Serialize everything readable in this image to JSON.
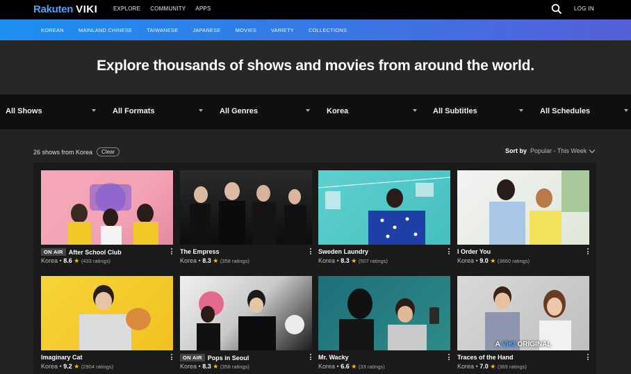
{
  "topbar": {
    "logo_part1": "Rakuten",
    "logo_part2": "VIKI",
    "nav": [
      "EXPLORE",
      "COMMUNITY",
      "APPS"
    ],
    "login": "LOG IN"
  },
  "categories": [
    "KOREAN",
    "MAINLAND CHINESE",
    "TAIWANESE",
    "JAPANESE",
    "MOVIES",
    "VARIETY",
    "COLLECTIONS"
  ],
  "hero": {
    "title": "Explore thousands of shows and movies from around the world."
  },
  "filters": [
    "All Shows",
    "All Formats",
    "All Genres",
    "Korea",
    "All Subtitles",
    "All Schedules"
  ],
  "results": {
    "count_text": "26 shows from Korea",
    "clear_label": "Clear",
    "sort_label": "Sort by",
    "sort_value": "Popular - This Week"
  },
  "shows": [
    {
      "title": "After School Club",
      "badge": "ON AIR",
      "country": "Korea",
      "rating": "8.6",
      "ratings_count": "(433 ratings)"
    },
    {
      "title": "The Empress",
      "badge": "",
      "country": "Korea",
      "rating": "8.3",
      "ratings_count": "(358 ratings)"
    },
    {
      "title": "Sweden Laundry",
      "badge": "",
      "country": "Korea",
      "rating": "8.3",
      "ratings_count": "(507 ratings)"
    },
    {
      "title": "I Order You",
      "badge": "",
      "country": "Korea",
      "rating": "9.0",
      "ratings_count": "(3660 ratings)"
    },
    {
      "title": "Imaginary Cat",
      "badge": "",
      "country": "Korea",
      "rating": "9.2",
      "ratings_count": "(2904 ratings)"
    },
    {
      "title": "Pops in Seoul",
      "badge": "ON AIR",
      "country": "Korea",
      "rating": "8.3",
      "ratings_count": "(358 ratings)"
    },
    {
      "title": "Mr. Wacky",
      "badge": "",
      "country": "Korea",
      "rating": "6.6",
      "ratings_count": "(33 ratings)"
    },
    {
      "title": "Traces of the Hand",
      "badge": "",
      "country": "Korea",
      "rating": "7.0",
      "ratings_count": "(369 ratings)",
      "overlay_pre": "A",
      "overlay_brand": "VIKI",
      "overlay_post": "ORIGINAL"
    }
  ],
  "colors": {
    "accent": "#1d8ff0",
    "star": "#f2c200"
  }
}
